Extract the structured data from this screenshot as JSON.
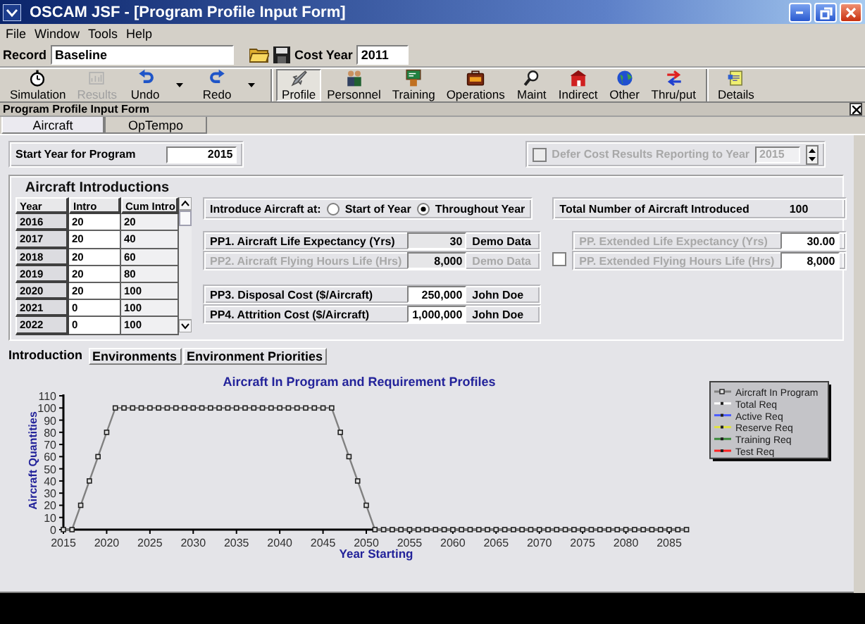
{
  "window": {
    "title": "OSCAM JSF - [Program Profile Input Form]"
  },
  "menu": [
    "File",
    "Window",
    "Tools",
    "Help"
  ],
  "record_bar": {
    "record_label": "Record",
    "record_value": "Baseline",
    "cost_year_label": "Cost Year",
    "cost_year_value": "2011"
  },
  "toolbar": {
    "groups": [
      {
        "items": [
          {
            "label": "Simulation",
            "kind": "stopwatch",
            "disabled": false,
            "pressed": false,
            "dropdown": false
          },
          {
            "label": "Results",
            "kind": "chart",
            "disabled": true,
            "pressed": false,
            "dropdown": false
          },
          {
            "label": "Undo",
            "kind": "undo",
            "disabled": false,
            "pressed": false,
            "dropdown": true
          },
          {
            "label": "Redo",
            "kind": "redo",
            "disabled": false,
            "pressed": false,
            "dropdown": true
          }
        ]
      },
      {
        "items": [
          {
            "label": "Profile",
            "kind": "jet",
            "disabled": false,
            "pressed": true,
            "dropdown": false
          },
          {
            "label": "Personnel",
            "kind": "people",
            "disabled": false,
            "pressed": false,
            "dropdown": false
          },
          {
            "label": "Training",
            "kind": "board",
            "disabled": false,
            "pressed": false,
            "dropdown": false
          },
          {
            "label": "Operations",
            "kind": "case",
            "disabled": false,
            "pressed": false,
            "dropdown": false
          },
          {
            "label": "Maint",
            "kind": "magnifier",
            "disabled": false,
            "pressed": false,
            "dropdown": false
          },
          {
            "label": "Indirect",
            "kind": "building",
            "disabled": false,
            "pressed": false,
            "dropdown": false
          },
          {
            "label": "Other",
            "kind": "globe",
            "disabled": false,
            "pressed": false,
            "dropdown": false
          },
          {
            "label": "Thru/put",
            "kind": "arrows",
            "disabled": false,
            "pressed": false,
            "dropdown": false
          }
        ]
      },
      {
        "items": [
          {
            "label": "Details",
            "kind": "note",
            "disabled": false,
            "pressed": false,
            "dropdown": false
          }
        ]
      }
    ]
  },
  "form": {
    "title": "Program Profile Input Form"
  },
  "tabs": [
    {
      "label": "Aircraft",
      "selected": true
    },
    {
      "label": "OpTempo",
      "selected": false
    }
  ],
  "start_year": {
    "label": "Start Year for Program",
    "value": "2015"
  },
  "defer": {
    "label": "Defer Cost Results Reporting to Year",
    "checked": false,
    "disabled": true,
    "value": "2015"
  },
  "introductions": {
    "title": "Aircraft Introductions",
    "columns": [
      "Year",
      "Intro",
      "Cum Intro"
    ],
    "rows": [
      [
        "2016",
        "20",
        "20"
      ],
      [
        "2017",
        "20",
        "40"
      ],
      [
        "2018",
        "20",
        "60"
      ],
      [
        "2019",
        "20",
        "80"
      ],
      [
        "2020",
        "20",
        "100"
      ],
      [
        "2021",
        "0",
        "100"
      ],
      [
        "2022",
        "0",
        "100"
      ]
    ]
  },
  "introduce_at": {
    "label": "Introduce Aircraft at:",
    "options": [
      {
        "label": "Start of Year",
        "selected": false
      },
      {
        "label": "Throughout Year",
        "selected": true
      }
    ]
  },
  "total": {
    "label": "Total Number of Aircraft Introduced",
    "value": "100"
  },
  "parameter_groups": [
    [
      {
        "label": "PP1. Aircraft Life Expectancy (Yrs)",
        "value": "30",
        "source": "Demo Data",
        "disabled": false,
        "editable": false
      },
      {
        "label": "PP2. Aircraft Flying Hours Life (Hrs)",
        "value": "8,000",
        "source": "Demo Data",
        "disabled": true,
        "editable": false
      }
    ],
    [
      {
        "label": "PP3. Disposal Cost ($/Aircraft)",
        "value": "250,000",
        "source": "John Doe",
        "disabled": false,
        "editable": true
      },
      {
        "label": "PP4. Attrition Cost ($/Aircraft)",
        "value": "1,000,000",
        "source": "John Doe",
        "disabled": false,
        "editable": true
      }
    ]
  ],
  "extended": {
    "checked": false,
    "items": [
      {
        "label": "PP. Extended Life Expectancy (Yrs)",
        "value": "30.00"
      },
      {
        "label": "PP. Extended Flying Hours Life (Hrs)",
        "value": "8,000"
      }
    ]
  },
  "bottom_tabs": [
    {
      "label": "Introduction",
      "selected": true
    },
    {
      "label": "Environments",
      "selected": false
    },
    {
      "label": "Environment Priorities",
      "selected": false
    }
  ],
  "chart": {
    "chart_data": {
      "type": "line",
      "title": "Aircraft In Program and Requirement Profiles",
      "xlabel": "Year Starting",
      "ylabel": "Aircraft Quantities",
      "x": [
        2015,
        2016,
        2017,
        2018,
        2019,
        2020,
        2021,
        2022,
        2023,
        2024,
        2025,
        2026,
        2027,
        2028,
        2029,
        2030,
        2031,
        2032,
        2033,
        2034,
        2035,
        2036,
        2037,
        2038,
        2039,
        2040,
        2041,
        2042,
        2043,
        2044,
        2045,
        2046,
        2047,
        2048,
        2049,
        2050,
        2051,
        2052,
        2053,
        2054,
        2055,
        2056,
        2057,
        2058,
        2059,
        2060,
        2061,
        2062,
        2063,
        2064,
        2065,
        2066,
        2067,
        2068,
        2069,
        2070,
        2071,
        2072,
        2073,
        2074,
        2075,
        2076,
        2077,
        2078,
        2079,
        2080,
        2081,
        2082,
        2083,
        2084,
        2085,
        2086,
        2087
      ],
      "series": [
        {
          "name": "Aircraft In Program",
          "color": "#808080",
          "marker": "square",
          "values": [
            0,
            0,
            20,
            40,
            60,
            80,
            100,
            100,
            100,
            100,
            100,
            100,
            100,
            100,
            100,
            100,
            100,
            100,
            100,
            100,
            100,
            100,
            100,
            100,
            100,
            100,
            100,
            100,
            100,
            100,
            100,
            100,
            80,
            60,
            40,
            20,
            0,
            0,
            0,
            0,
            0,
            0,
            0,
            0,
            0,
            0,
            0,
            0,
            0,
            0,
            0,
            0,
            0,
            0,
            0,
            0,
            0,
            0,
            0,
            0,
            0,
            0,
            0,
            0,
            0,
            0,
            0,
            0,
            0,
            0,
            0,
            0,
            0
          ]
        }
      ],
      "xlim": [
        2015,
        2087
      ],
      "ylim": [
        0,
        110
      ],
      "xticks": [
        2015,
        2020,
        2025,
        2030,
        2035,
        2040,
        2045,
        2050,
        2055,
        2060,
        2065,
        2070,
        2075,
        2080,
        2085
      ],
      "yticks": [
        0,
        10,
        20,
        30,
        40,
        50,
        60,
        70,
        80,
        90,
        100,
        110
      ]
    },
    "legend": [
      {
        "name": "Total Req",
        "color": "#ffffff"
      },
      {
        "name": "Active Req",
        "color": "#4a5cff"
      },
      {
        "name": "Reserve Req",
        "color": "#e0e040"
      },
      {
        "name": "Training Req",
        "color": "#3c8a3c"
      },
      {
        "name": "Test Req",
        "color": "#ff2020"
      }
    ]
  }
}
